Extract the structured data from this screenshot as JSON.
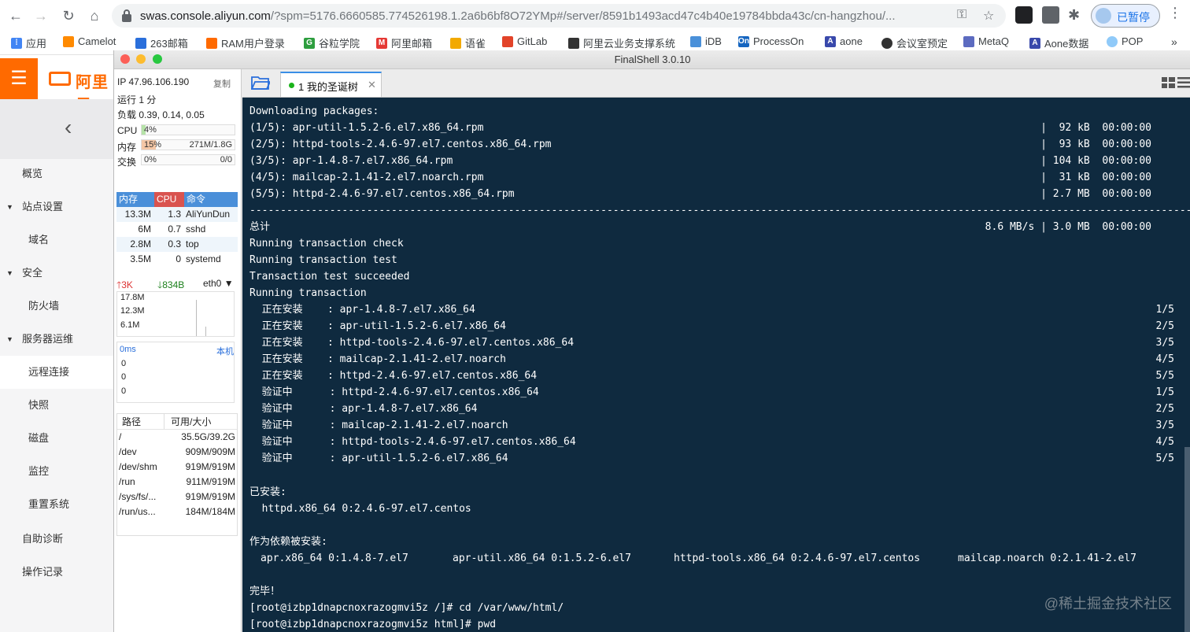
{
  "browser": {
    "url_host": "swas.console.aliyun.com",
    "url_path": "/?spm=5176.6660585.774526198.1.2a6b6bf8O72YMp#/server/8591b1493acd47c4b40e19784bbda43c/cn-hangzhou/...",
    "profile_status": "已暂停",
    "bookmarks": [
      "应用",
      "Camelot",
      "263邮箱",
      "RAM用户登录",
      "谷粒学院",
      "阿里邮箱",
      "语雀",
      "GitLab",
      "阿里云业务支撑系统",
      "iDB",
      "ProcessOn",
      "aone",
      "会议室预定",
      "MetaQ",
      "Aone数据",
      "POP"
    ]
  },
  "aliyun": {
    "logo_text": "阿里云",
    "nav": [
      {
        "label": "概览",
        "kind": "top"
      },
      {
        "label": "站点设置",
        "kind": "group"
      },
      {
        "label": "域名",
        "kind": "sub"
      },
      {
        "label": "安全",
        "kind": "group"
      },
      {
        "label": "防火墙",
        "kind": "sub"
      },
      {
        "label": "服务器运维",
        "kind": "group"
      },
      {
        "label": "远程连接",
        "kind": "sub",
        "active": true
      },
      {
        "label": "快照",
        "kind": "sub"
      },
      {
        "label": "磁盘",
        "kind": "sub"
      },
      {
        "label": "监控",
        "kind": "sub"
      },
      {
        "label": "重置系统",
        "kind": "sub"
      },
      {
        "label": "自助诊断",
        "kind": "top"
      },
      {
        "label": "操作记录",
        "kind": "top"
      }
    ]
  },
  "finalshell": {
    "title": "FinalShell 3.0.10",
    "ip": "IP 47.96.106.190",
    "copy": "复制",
    "uptime": "运行 1 分",
    "load": "负载 0.39, 0.14, 0.05",
    "cpu": {
      "label": "CPU",
      "pct": "4%",
      "value": 0.04
    },
    "mem": {
      "label": "内存",
      "pct": "15%",
      "value": 0.15,
      "amount": "271M/1.8G"
    },
    "swap": {
      "label": "交换",
      "pct": "0%",
      "value": 0,
      "amount": "0/0"
    },
    "proc_headers": [
      "内存",
      "CPU",
      "命令"
    ],
    "processes": [
      [
        "13.3M",
        "1.3",
        "AliYunDun"
      ],
      [
        "6M",
        "0.7",
        "sshd"
      ],
      [
        "2.8M",
        "0.3",
        "top"
      ],
      [
        "3.5M",
        "0",
        "systemd"
      ]
    ],
    "net": {
      "up": "3K",
      "down": "834B",
      "iface": "eth0",
      "scale": [
        "17.8M",
        "12.3M",
        "6.1M"
      ]
    },
    "latency": {
      "label": "0ms",
      "host": "本机",
      "values": [
        "0",
        "0",
        "0"
      ]
    },
    "disk_headers": [
      "路径",
      "可用/大小"
    ],
    "disks": [
      [
        "/",
        "35.5G/39.2G"
      ],
      [
        "/dev",
        "909M/909M"
      ],
      [
        "/dev/shm",
        "919M/919M"
      ],
      [
        "/run",
        "911M/919M"
      ],
      [
        "/sys/fs/...",
        "919M/919M"
      ],
      [
        "/run/us...",
        "184M/184M"
      ]
    ],
    "tab_label": "1  我的圣诞树"
  },
  "terminal": {
    "downloading": "Downloading packages:",
    "packages": [
      {
        "name": "(1/5): apr-util-1.5.2-6.el7.x86_64.rpm",
        "size": "|  92 kB  00:00:00"
      },
      {
        "name": "(2/5): httpd-tools-2.4.6-97.el7.centos.x86_64.rpm",
        "size": "|  93 kB  00:00:00"
      },
      {
        "name": "(3/5): apr-1.4.8-7.el7.x86_64.rpm",
        "size": "| 104 kB  00:00:00"
      },
      {
        "name": "(4/5): mailcap-2.1.41-2.el7.noarch.rpm",
        "size": "|  31 kB  00:00:00"
      },
      {
        "name": "(5/5): httpd-2.4.6-97.el7.centos.x86_64.rpm",
        "size": "| 2.7 MB  00:00:00"
      }
    ],
    "separator": "--------------------------------------------------------------------------------------------------------------------------------------------------------------------------",
    "total_label": "总计",
    "total_value": "8.6 MB/s | 3.0 MB  00:00:00",
    "steps": [
      "Running transaction check",
      "Running transaction test",
      "Transaction test succeeded",
      "Running transaction"
    ],
    "actions": [
      {
        "text": "  正在安装    : apr-1.4.8-7.el7.x86_64",
        "count": "1/5"
      },
      {
        "text": "  正在安装    : apr-util-1.5.2-6.el7.x86_64",
        "count": "2/5"
      },
      {
        "text": "  正在安装    : httpd-tools-2.4.6-97.el7.centos.x86_64",
        "count": "3/5"
      },
      {
        "text": "  正在安装    : mailcap-2.1.41-2.el7.noarch",
        "count": "4/5"
      },
      {
        "text": "  正在安装    : httpd-2.4.6-97.el7.centos.x86_64",
        "count": "5/5"
      },
      {
        "text": "  验证中      : httpd-2.4.6-97.el7.centos.x86_64",
        "count": "1/5"
      },
      {
        "text": "  验证中      : apr-1.4.8-7.el7.x86_64",
        "count": "2/5"
      },
      {
        "text": "  验证中      : mailcap-2.1.41-2.el7.noarch",
        "count": "3/5"
      },
      {
        "text": "  验证中      : httpd-tools-2.4.6-97.el7.centos.x86_64",
        "count": "4/5"
      },
      {
        "text": "  验证中      : apr-util-1.5.2-6.el7.x86_64",
        "count": "5/5"
      }
    ],
    "installed_label": "已安装:",
    "installed_pkg": "  httpd.x86_64 0:2.4.6-97.el7.centos",
    "deps_label": "作为依赖被安装:",
    "deps": [
      "apr.x86_64 0:1.4.8-7.el7",
      "apr-util.x86_64 0:1.5.2-6.el7",
      "httpd-tools.x86_64 0:2.4.6-97.el7.centos",
      "mailcap.noarch 0:2.1.41-2.el7"
    ],
    "done": "完毕！",
    "cmd1": "[root@izbp1dnapcnoxrazogmvi5z /]# cd /var/www/html/",
    "cmd2": "[root@izbp1dnapcnoxrazogmvi5z html]# pwd"
  },
  "watermark": "@稀土掘金技术社区"
}
